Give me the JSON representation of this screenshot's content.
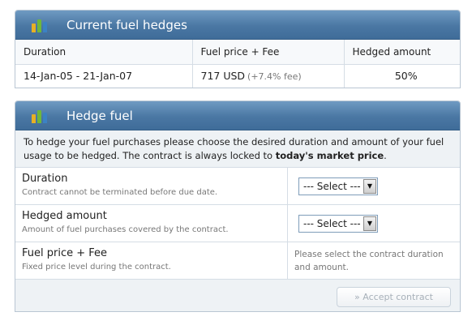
{
  "current_hedges": {
    "title": "Current fuel hedges",
    "icon": "bar-chart-icon",
    "columns": [
      "Duration",
      "Fuel price + Fee",
      "Hedged amount"
    ],
    "rows": [
      {
        "duration": "14-Jan-05 - 21-Jan-07",
        "price": "717 USD",
        "fee": "(+7.4% fee)",
        "amount": "50%"
      }
    ]
  },
  "hedge_fuel": {
    "title": "Hedge fuel",
    "icon": "bar-chart-icon",
    "intro_text": "To hedge your fuel purchases please choose the desired duration and amount of your fuel usage to be hedged. The contract is always locked to ",
    "intro_bold": "today's market price",
    "intro_end": ".",
    "duration_label": "Duration",
    "duration_sub": "Contract cannot be terminated before due date.",
    "duration_select": "--- Select ---",
    "amount_label": "Hedged amount",
    "amount_sub": "Amount of fuel purchases covered by the contract.",
    "amount_select": "--- Select ---",
    "price_label": "Fuel price + Fee",
    "price_sub": "Fixed price level during the contract.",
    "price_note": "Please select the contract duration and amount.",
    "accept_label": "» Accept contract"
  },
  "colors": {
    "header_blue": "#4a77a3",
    "panel_bg": "#eef2f5",
    "border": "#d5dde5"
  }
}
